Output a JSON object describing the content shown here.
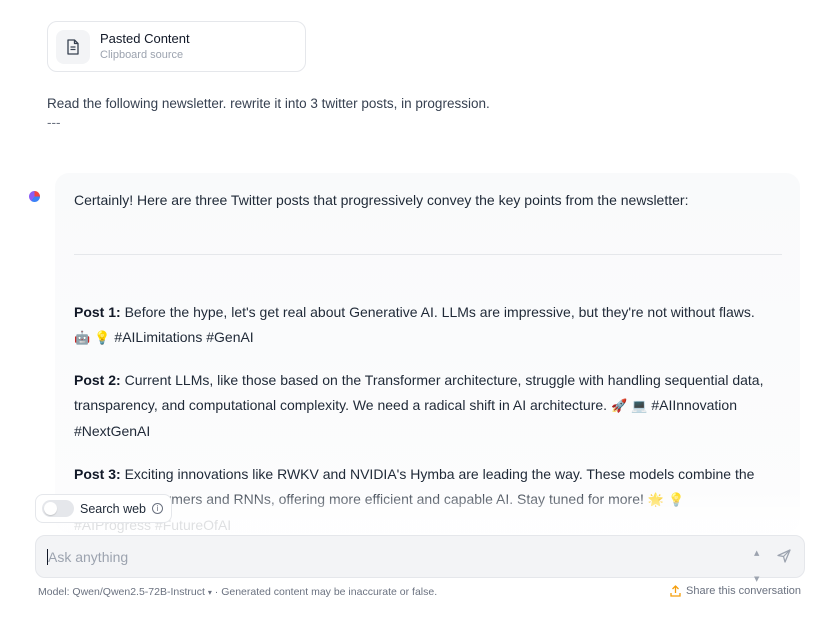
{
  "pasted_card": {
    "title": "Pasted Content",
    "subtitle": "Clipboard source",
    "icon": "document-icon"
  },
  "user_message": {
    "text": "Read the following newsletter.  rewrite it into 3 twitter posts, in progression.",
    "separator": "---"
  },
  "assistant": {
    "intro": "Certainly! Here are three Twitter posts that progressively convey the key points from the newsletter:",
    "posts": [
      {
        "label": "Post 1:",
        "line1": " Before the hype, let's get real about Generative AI. LLMs are impressive, but they're not without flaws.",
        "emojis": "🤖 💡",
        "tags": " #AILimitations #GenAI"
      },
      {
        "label": "Post 2:",
        "line1": " Current LLMs, like those based on the Transformer architecture, struggle with handling sequential data,",
        "line2": "transparency, and computational complexity. We need a radical shift in AI architecture.",
        "emojis": "🚀 💻",
        "tags": " #AIInnovation",
        "line3": "#NextGenAI"
      },
      {
        "label": "Post 3:",
        "line1": " Exciting innovations like RWKV and NVIDIA's Hymba are leading the way. These models combine the",
        "line2": "best of Transformers and RNNs, offering more efficient and capable AI. Stay tuned for more!",
        "emojis": "🌟 💡",
        "line3": "#AIProgress #FutureOfAI"
      }
    ]
  },
  "search_web": {
    "label": "Search web",
    "enabled": false,
    "info_icon": "info-icon"
  },
  "composer": {
    "placeholder": "Ask anything",
    "value": "",
    "send_icon": "send-icon"
  },
  "footer": {
    "model_label": "Model: Qwen/Qwen2.5-72B-Instruct",
    "disclaimer": " · Generated content may be inaccurate or false.",
    "share_label": "Share this conversation",
    "share_icon": "share-icon"
  },
  "colors": {
    "accent_orange": "#f59e0b",
    "bubble_bg": "#f9fafb",
    "input_bg": "#f3f4f6"
  }
}
